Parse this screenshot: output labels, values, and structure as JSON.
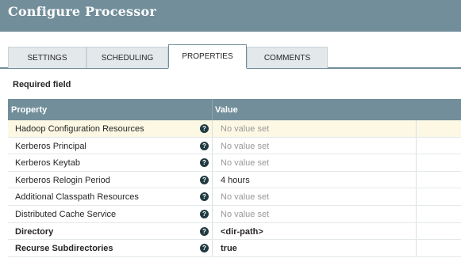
{
  "dialog": {
    "title": "Configure Processor"
  },
  "tabs": [
    {
      "label": "Settings"
    },
    {
      "label": "Scheduling"
    },
    {
      "label": "Properties",
      "active": true
    },
    {
      "label": "Comments"
    }
  ],
  "required_label": "Required field",
  "table": {
    "headers": {
      "property": "Property",
      "value": "Value"
    },
    "rows": [
      {
        "name": "Hadoop Configuration Resources",
        "value": "No value set",
        "required": false,
        "empty": true
      },
      {
        "name": "Kerberos Principal",
        "value": "No value set",
        "required": false,
        "empty": true
      },
      {
        "name": "Kerberos Keytab",
        "value": "No value set",
        "required": false,
        "empty": true
      },
      {
        "name": "Kerberos Relogin Period",
        "value": "4 hours",
        "required": false,
        "empty": false
      },
      {
        "name": "Additional Classpath Resources",
        "value": "No value set",
        "required": false,
        "empty": true
      },
      {
        "name": "Distributed Cache Service",
        "value": "No value set",
        "required": false,
        "empty": true
      },
      {
        "name": "Directory",
        "value": "<dir-path>",
        "required": true,
        "empty": false
      },
      {
        "name": "Recurse Subdirectories",
        "value": "true",
        "required": true,
        "empty": false
      }
    ]
  },
  "help_icon": "question-circle-icon",
  "colors": {
    "header": "#728e9b",
    "selected_row": "#fdf8e4",
    "tab_inactive": "#e3e8eb"
  }
}
